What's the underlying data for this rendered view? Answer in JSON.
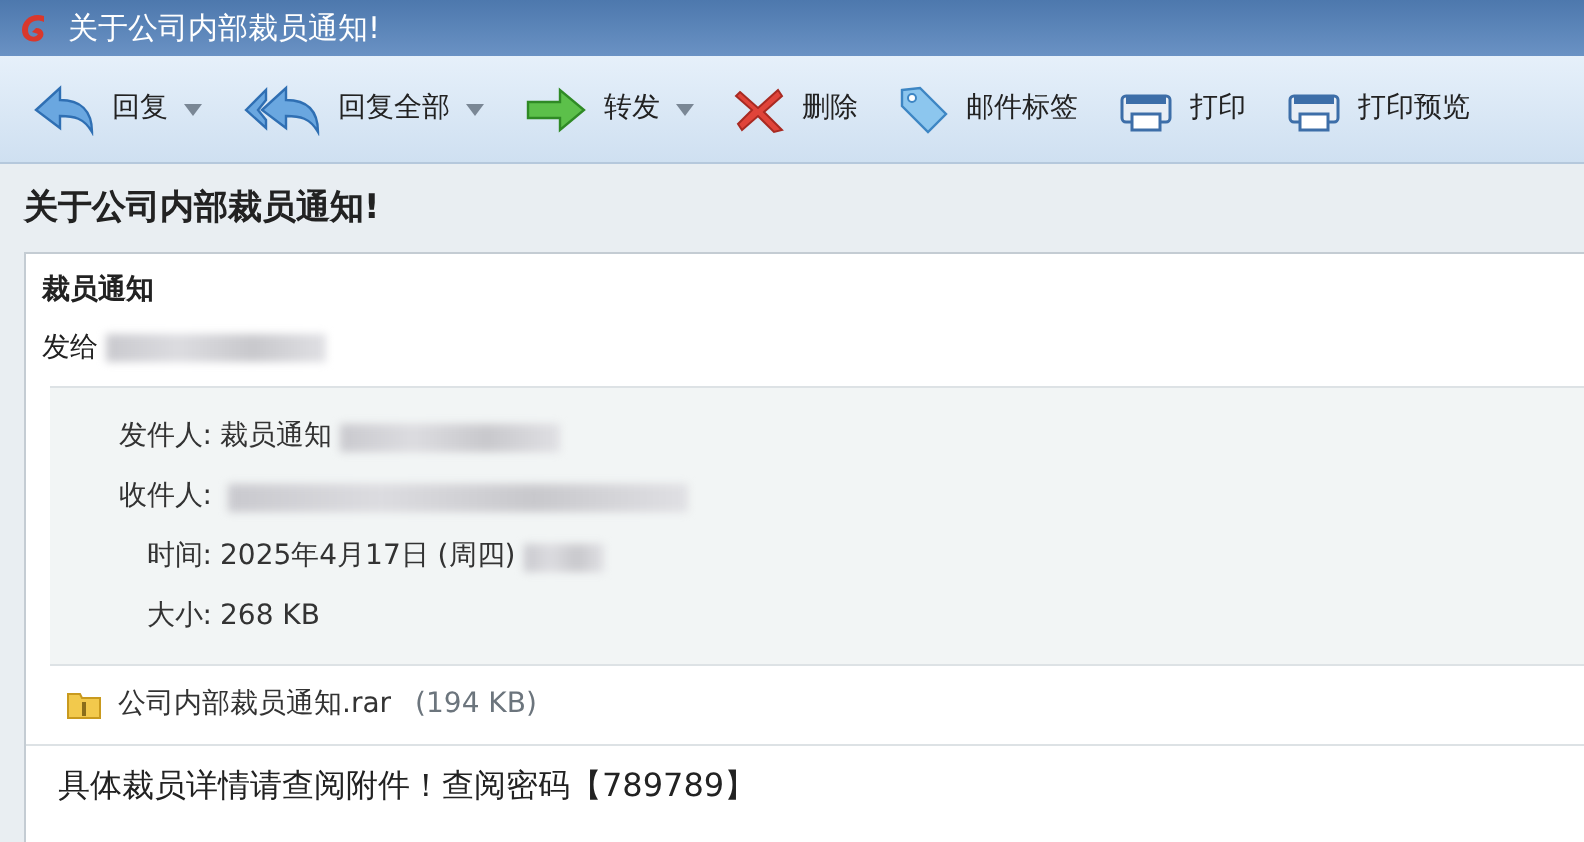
{
  "window": {
    "title": "关于公司内部裁员通知!"
  },
  "toolbar": [
    {
      "label": "回复",
      "kind": "reply",
      "dropdown": true
    },
    {
      "label": "回复全部",
      "kind": "reply-all",
      "dropdown": true
    },
    {
      "label": "转发",
      "kind": "forward",
      "dropdown": true
    },
    {
      "label": "删除",
      "kind": "delete",
      "dropdown": false
    },
    {
      "label": "邮件标签",
      "kind": "tag",
      "dropdown": false
    },
    {
      "label": "打印",
      "kind": "print",
      "dropdown": false
    },
    {
      "label": "打印预览",
      "kind": "print",
      "dropdown": false
    }
  ],
  "subject": "关于公司内部裁员通知!",
  "message": {
    "sender_name": "裁员通知",
    "to_label": "发给",
    "details": [
      {
        "label": "发件人:",
        "value": "裁员通知",
        "redacted": true
      },
      {
        "label": "收件人:",
        "redacted": true
      },
      {
        "label": "时间:",
        "value": "2025年4月17日 (周四)",
        "redacted": true
      },
      {
        "label": "大小:",
        "value": "268 KB",
        "redacted": false
      }
    ],
    "attachment": {
      "name": "公司内部裁员通知.rar",
      "size": "(194 KB)"
    },
    "body": "具体裁员详情请查阅附件！查阅密码【789789】"
  }
}
